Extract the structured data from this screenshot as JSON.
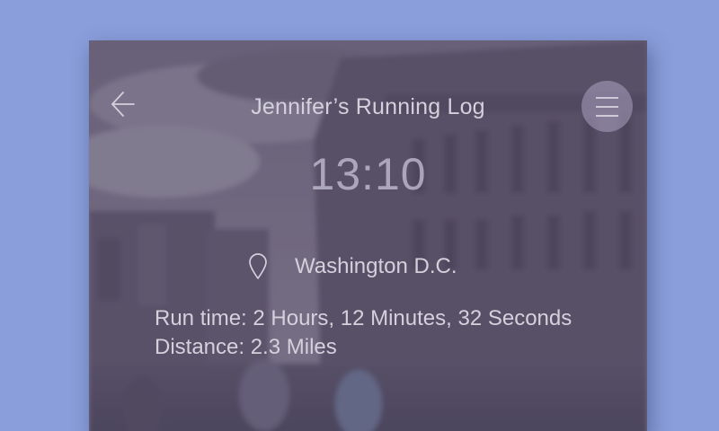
{
  "app": {
    "title": "Jennifer’s Running Log"
  },
  "header": {
    "back_icon": "back-arrow-icon",
    "menu_icon": "hamburger-menu-icon"
  },
  "clock": {
    "time": "13:10"
  },
  "location": {
    "icon": "location-pin-icon",
    "name": "Washington D.C."
  },
  "stats": {
    "run_time": "Run time: 2 Hours, 12 Minutes, 32 Seconds",
    "distance": "Distance: 2.3 Miles"
  },
  "colors": {
    "page_background": "#8a9edb",
    "text": "#d4d0dc",
    "overlay": "#4e4664"
  }
}
